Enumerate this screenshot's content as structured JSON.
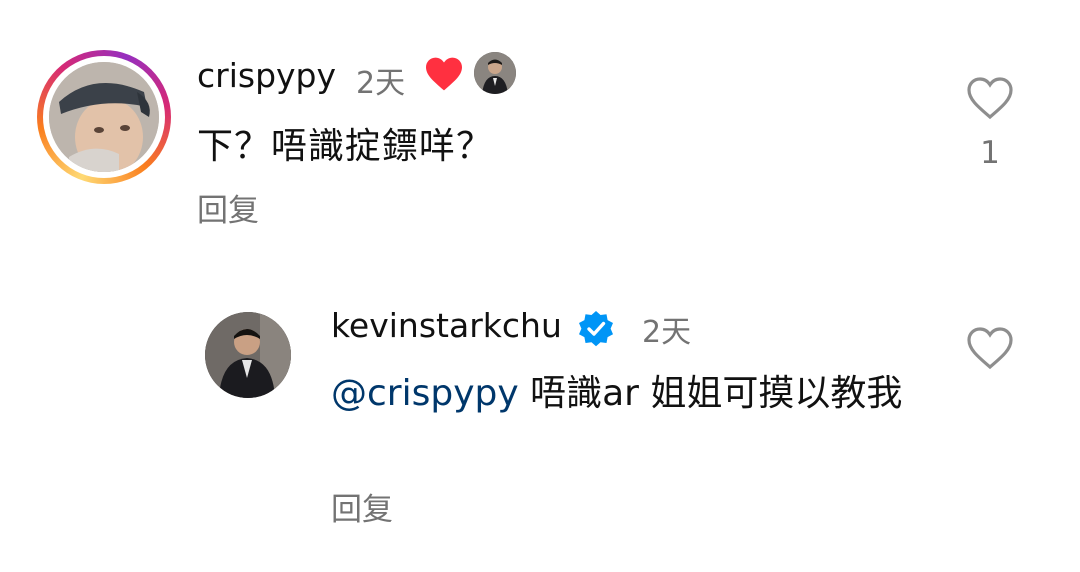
{
  "comments": [
    {
      "username": "crispypy",
      "time": "2天",
      "text": "下？唔識掟鏢咩？",
      "reply_label": "回复",
      "like_count": "1",
      "liked_by_author": true
    },
    {
      "username": "kevinstarkchu",
      "verified": true,
      "time": "2天",
      "mention": "@crispypy",
      "text": " 唔識ar 姐姐可摸以教我",
      "reply_label": "回复"
    }
  ],
  "colors": {
    "heart_red": "#ff3040",
    "verified_blue": "#0095f6",
    "mention_blue": "#00376b",
    "muted_gray": "#737373"
  }
}
